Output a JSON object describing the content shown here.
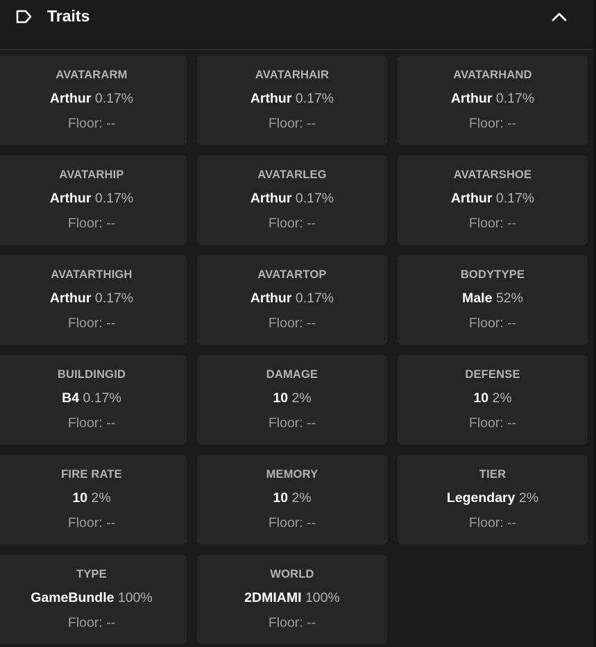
{
  "header": {
    "title": "Traits",
    "icon": "tag-icon",
    "collapse_icon": "chevron-up-icon"
  },
  "traits": [
    {
      "type": "AVATARARM",
      "value": "Arthur",
      "rarity": "0.17%",
      "floor": "Floor: --"
    },
    {
      "type": "AVATARHAIR",
      "value": "Arthur",
      "rarity": "0.17%",
      "floor": "Floor: --"
    },
    {
      "type": "AVATARHAND",
      "value": "Arthur",
      "rarity": "0.17%",
      "floor": "Floor: --"
    },
    {
      "type": "AVATARHIP",
      "value": "Arthur",
      "rarity": "0.17%",
      "floor": "Floor: --"
    },
    {
      "type": "AVATARLEG",
      "value": "Arthur",
      "rarity": "0.17%",
      "floor": "Floor: --"
    },
    {
      "type": "AVATARSHOE",
      "value": "Arthur",
      "rarity": "0.17%",
      "floor": "Floor: --"
    },
    {
      "type": "AVATARTHIGH",
      "value": "Arthur",
      "rarity": "0.17%",
      "floor": "Floor: --"
    },
    {
      "type": "AVATARTOP",
      "value": "Arthur",
      "rarity": "0.17%",
      "floor": "Floor: --"
    },
    {
      "type": "BODYTYPE",
      "value": "Male",
      "rarity": "52%",
      "floor": "Floor: --"
    },
    {
      "type": "BUILDINGID",
      "value": "B4",
      "rarity": "0.17%",
      "floor": "Floor: --"
    },
    {
      "type": "DAMAGE",
      "value": "10",
      "rarity": "2%",
      "floor": "Floor: --"
    },
    {
      "type": "DEFENSE",
      "value": "10",
      "rarity": "2%",
      "floor": "Floor: --"
    },
    {
      "type": "FIRE RATE",
      "value": "10",
      "rarity": "2%",
      "floor": "Floor: --"
    },
    {
      "type": "MEMORY",
      "value": "10",
      "rarity": "2%",
      "floor": "Floor: --"
    },
    {
      "type": "TIER",
      "value": "Legendary",
      "rarity": "2%",
      "floor": "Floor: --"
    },
    {
      "type": "TYPE",
      "value": "GameBundle",
      "rarity": "100%",
      "floor": "Floor: --"
    },
    {
      "type": "WORLD",
      "value": "2DMIAMI",
      "rarity": "100%",
      "floor": "Floor: --"
    }
  ],
  "colors": {
    "background": "#1b1b1b",
    "card": "#262626",
    "value_text": "#ffffff",
    "label_text": "#b3b3b3"
  }
}
